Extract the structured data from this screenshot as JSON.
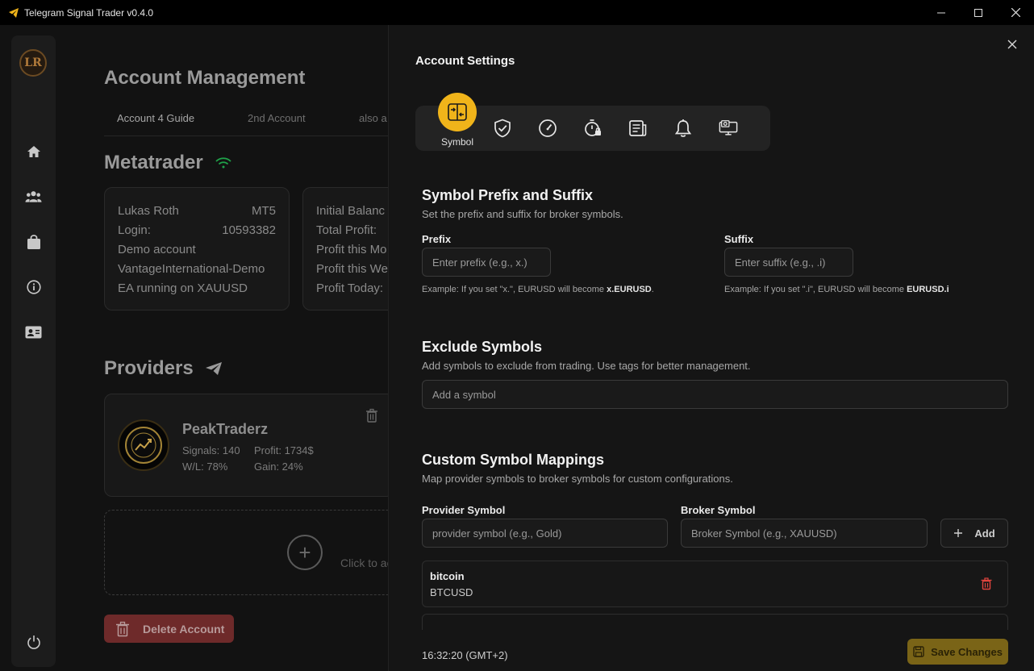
{
  "window": {
    "title": "Telegram Signal Trader v0.4.0"
  },
  "sidebar": {
    "logo_text": "LR"
  },
  "main": {
    "title": "Account Management",
    "tabs": [
      {
        "label": "Account 4 Guide"
      },
      {
        "label": "2nd Account"
      },
      {
        "label": "also a"
      }
    ],
    "metatrader": {
      "title": "Metatrader",
      "account": {
        "name": "Lukas Roth",
        "platform": "MT5",
        "login_label": "Login:",
        "login_value": "10593382",
        "type": "Demo account",
        "server": "VantageInternational-Demo",
        "ea_status": "EA running on XAUUSD"
      },
      "stats_labels": [
        "Initial Balanc",
        "Total Profit:",
        "Profit this Mo",
        "Profit this We",
        "Profit Today:"
      ]
    },
    "providers": {
      "title": "Providers",
      "items": [
        {
          "name": "PeakTraderz",
          "signals": "Signals: 140",
          "profit": "Profit: 1734$",
          "wl": "W/L: 78%",
          "gain": "Gain: 24%"
        }
      ],
      "add_text": "Click to ac"
    },
    "delete_account_label": "Delete Account"
  },
  "settings": {
    "title": "Account Settings",
    "active_tab_label": "Symbol",
    "prefix_suffix": {
      "title": "Symbol Prefix and Suffix",
      "description": "Set the prefix and suffix for broker symbols.",
      "prefix_label": "Prefix",
      "prefix_placeholder": "Enter prefix (e.g., x.)",
      "prefix_example_text": "Example: If you set \"x.\", EURUSD will become ",
      "prefix_example_result": "x.EURUSD",
      "suffix_label": "Suffix",
      "suffix_placeholder": "Enter suffix (e.g., .i)",
      "suffix_example_text": "Example: If you set \".i\", EURUSD will become ",
      "suffix_example_result": "EURUSD.i"
    },
    "exclude": {
      "title": "Exclude Symbols",
      "description": "Add symbols to exclude from trading. Use tags for better management.",
      "placeholder": "Add a symbol"
    },
    "mappings": {
      "title": "Custom Symbol Mappings",
      "description": "Map provider symbols to broker symbols for custom configurations.",
      "provider_label": "Provider Symbol",
      "provider_placeholder": "provider symbol (e.g., Gold)",
      "broker_label": "Broker Symbol",
      "broker_placeholder": "Broker Symbol (e.g., XAUUSD)",
      "add_label": "Add",
      "rows": [
        {
          "provider": "bitcoin",
          "broker": "BTCUSD"
        }
      ]
    },
    "clock": "16:32:20 (GMT+2)",
    "save_label": "Save Changes"
  },
  "colors": {
    "accent": "#f0b41a",
    "danger": "#6e2a2a",
    "signal_green": "#1fa34a"
  }
}
